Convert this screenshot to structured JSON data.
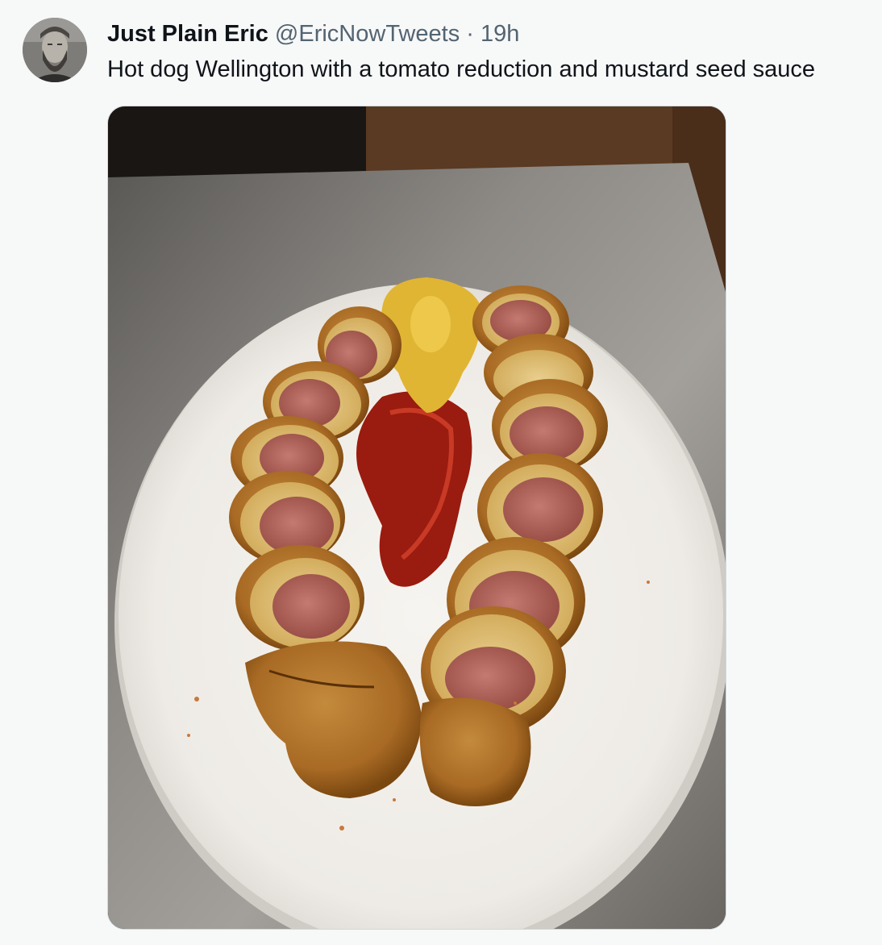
{
  "tweet": {
    "author_name": "Just Plain Eric",
    "handle": "@EricNowTweets",
    "separator": "·",
    "time_ago": "19h",
    "text": "Hot dog Wellington with a tomato reduction and mustard seed sauce"
  },
  "icons": {
    "avatar": "user-avatar-photo",
    "media": "food-photo"
  },
  "colors": {
    "text_primary": "#0f1419",
    "text_secondary": "#536471",
    "background": "#f7f8f8",
    "border": "#cfd9de"
  }
}
